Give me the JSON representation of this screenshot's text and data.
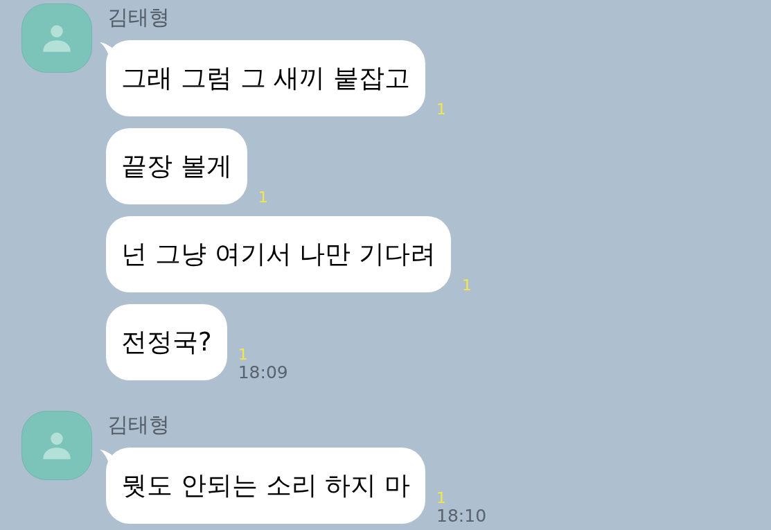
{
  "message_groups": [
    {
      "sender": "김태형",
      "messages": [
        {
          "text": "그래 그럼 그 새끼 붙잡고",
          "unread": "1"
        },
        {
          "text": "끝장 볼게",
          "unread": "1"
        },
        {
          "text": "넌 그냥 여기서 나만 기다려",
          "unread": "1"
        },
        {
          "text": "전정국?",
          "unread": "1",
          "time": "18:09"
        }
      ]
    },
    {
      "sender": "김태형",
      "messages": [
        {
          "text": "뭣도 안되는 소리 하지 마",
          "unread": "1",
          "time": "18:10"
        }
      ]
    }
  ]
}
